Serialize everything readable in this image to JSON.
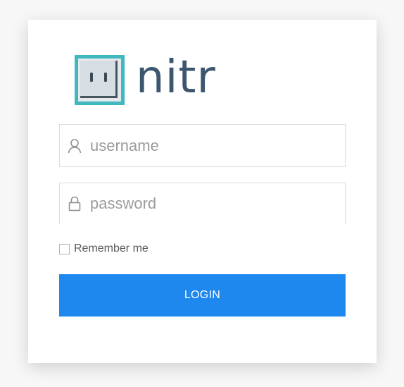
{
  "brand": {
    "name": "nitr",
    "accent_color": "#3fb8c0",
    "text_color": "#3d5670"
  },
  "form": {
    "username": {
      "icon": "user-icon",
      "placeholder": "username",
      "value": ""
    },
    "password": {
      "icon": "lock-icon",
      "placeholder": "password",
      "value": ""
    },
    "remember": {
      "label": "Remember me",
      "checked": false
    },
    "submit": {
      "label": "LOGIN",
      "color": "#1e88ef"
    }
  }
}
